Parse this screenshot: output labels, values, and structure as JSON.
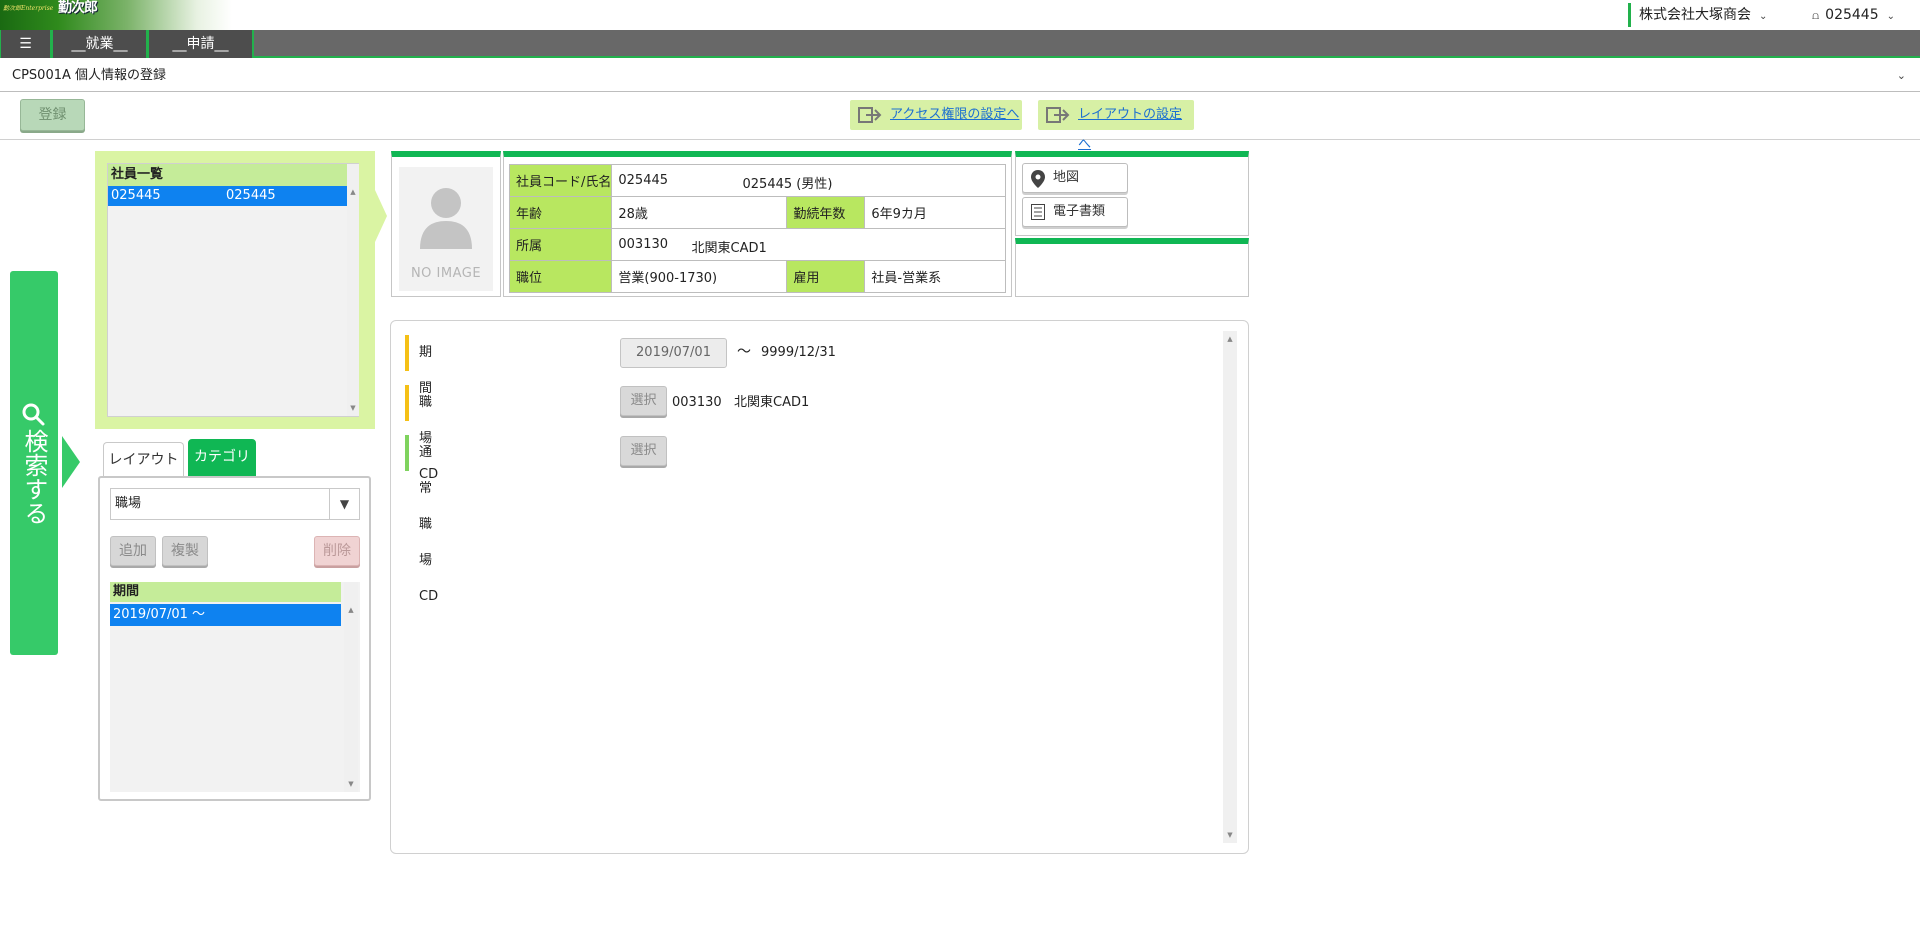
{
  "header": {
    "logo_small": "勤次郎Enterprise",
    "logo_big": "勤次郎",
    "company": "株式会社大塚商会",
    "user": "025445"
  },
  "menu": {
    "hamburger": "☰",
    "items": [
      "__就業__",
      "__申請__"
    ]
  },
  "screen": {
    "title": "CPS001A 個人情報の登録"
  },
  "actions": {
    "register": "登録",
    "access_link": "アクセス権限の設定へ",
    "layout_link": "レイアウトの設定へ"
  },
  "search_tab": {
    "label": "検索する"
  },
  "employee_list": {
    "header": "社員一覧",
    "rows": [
      {
        "code": "025445",
        "name": "025445"
      }
    ]
  },
  "tabs": {
    "layout": "レイアウト",
    "category": "カテゴリ"
  },
  "category_panel": {
    "selected": "職場",
    "add": "追加",
    "copy": "複製",
    "delete": "削除",
    "period_header": "期間",
    "period_rows": [
      "2019/07/01  ～"
    ]
  },
  "profile": {
    "no_image": "NO IMAGE",
    "code_name_label": "社員コード/氏名",
    "code": "025445",
    "name": "025445 (男性)",
    "age_label": "年齢",
    "age": "28歳",
    "tenure_label": "勤続年数",
    "tenure": "6年9カ月",
    "dept_label": "所属",
    "dept_code": "003130",
    "dept_name": "北関東CAD1",
    "position_label": "職位",
    "position": "営業(900-1730)",
    "employment_label": "雇用",
    "employment": "社員-営業系"
  },
  "side": {
    "map": "地図",
    "docs": "電子書類"
  },
  "details": {
    "period_label": "期間",
    "date_from": "2019/07/01",
    "tilde": "～",
    "date_to": "9999/12/31",
    "workplace_label": "職場CD",
    "select": "選択",
    "workplace_code": "003130",
    "workplace_name": "北関東CAD1",
    "normal_label": "通常職場CD"
  },
  "colors": {
    "accent_green": "#10b754",
    "light_green": "#daf4a3",
    "label_green": "#b8e760",
    "selected_blue": "#0e82f0",
    "required_bar": "#f5c016",
    "optional_bar": "#7fd35e"
  }
}
